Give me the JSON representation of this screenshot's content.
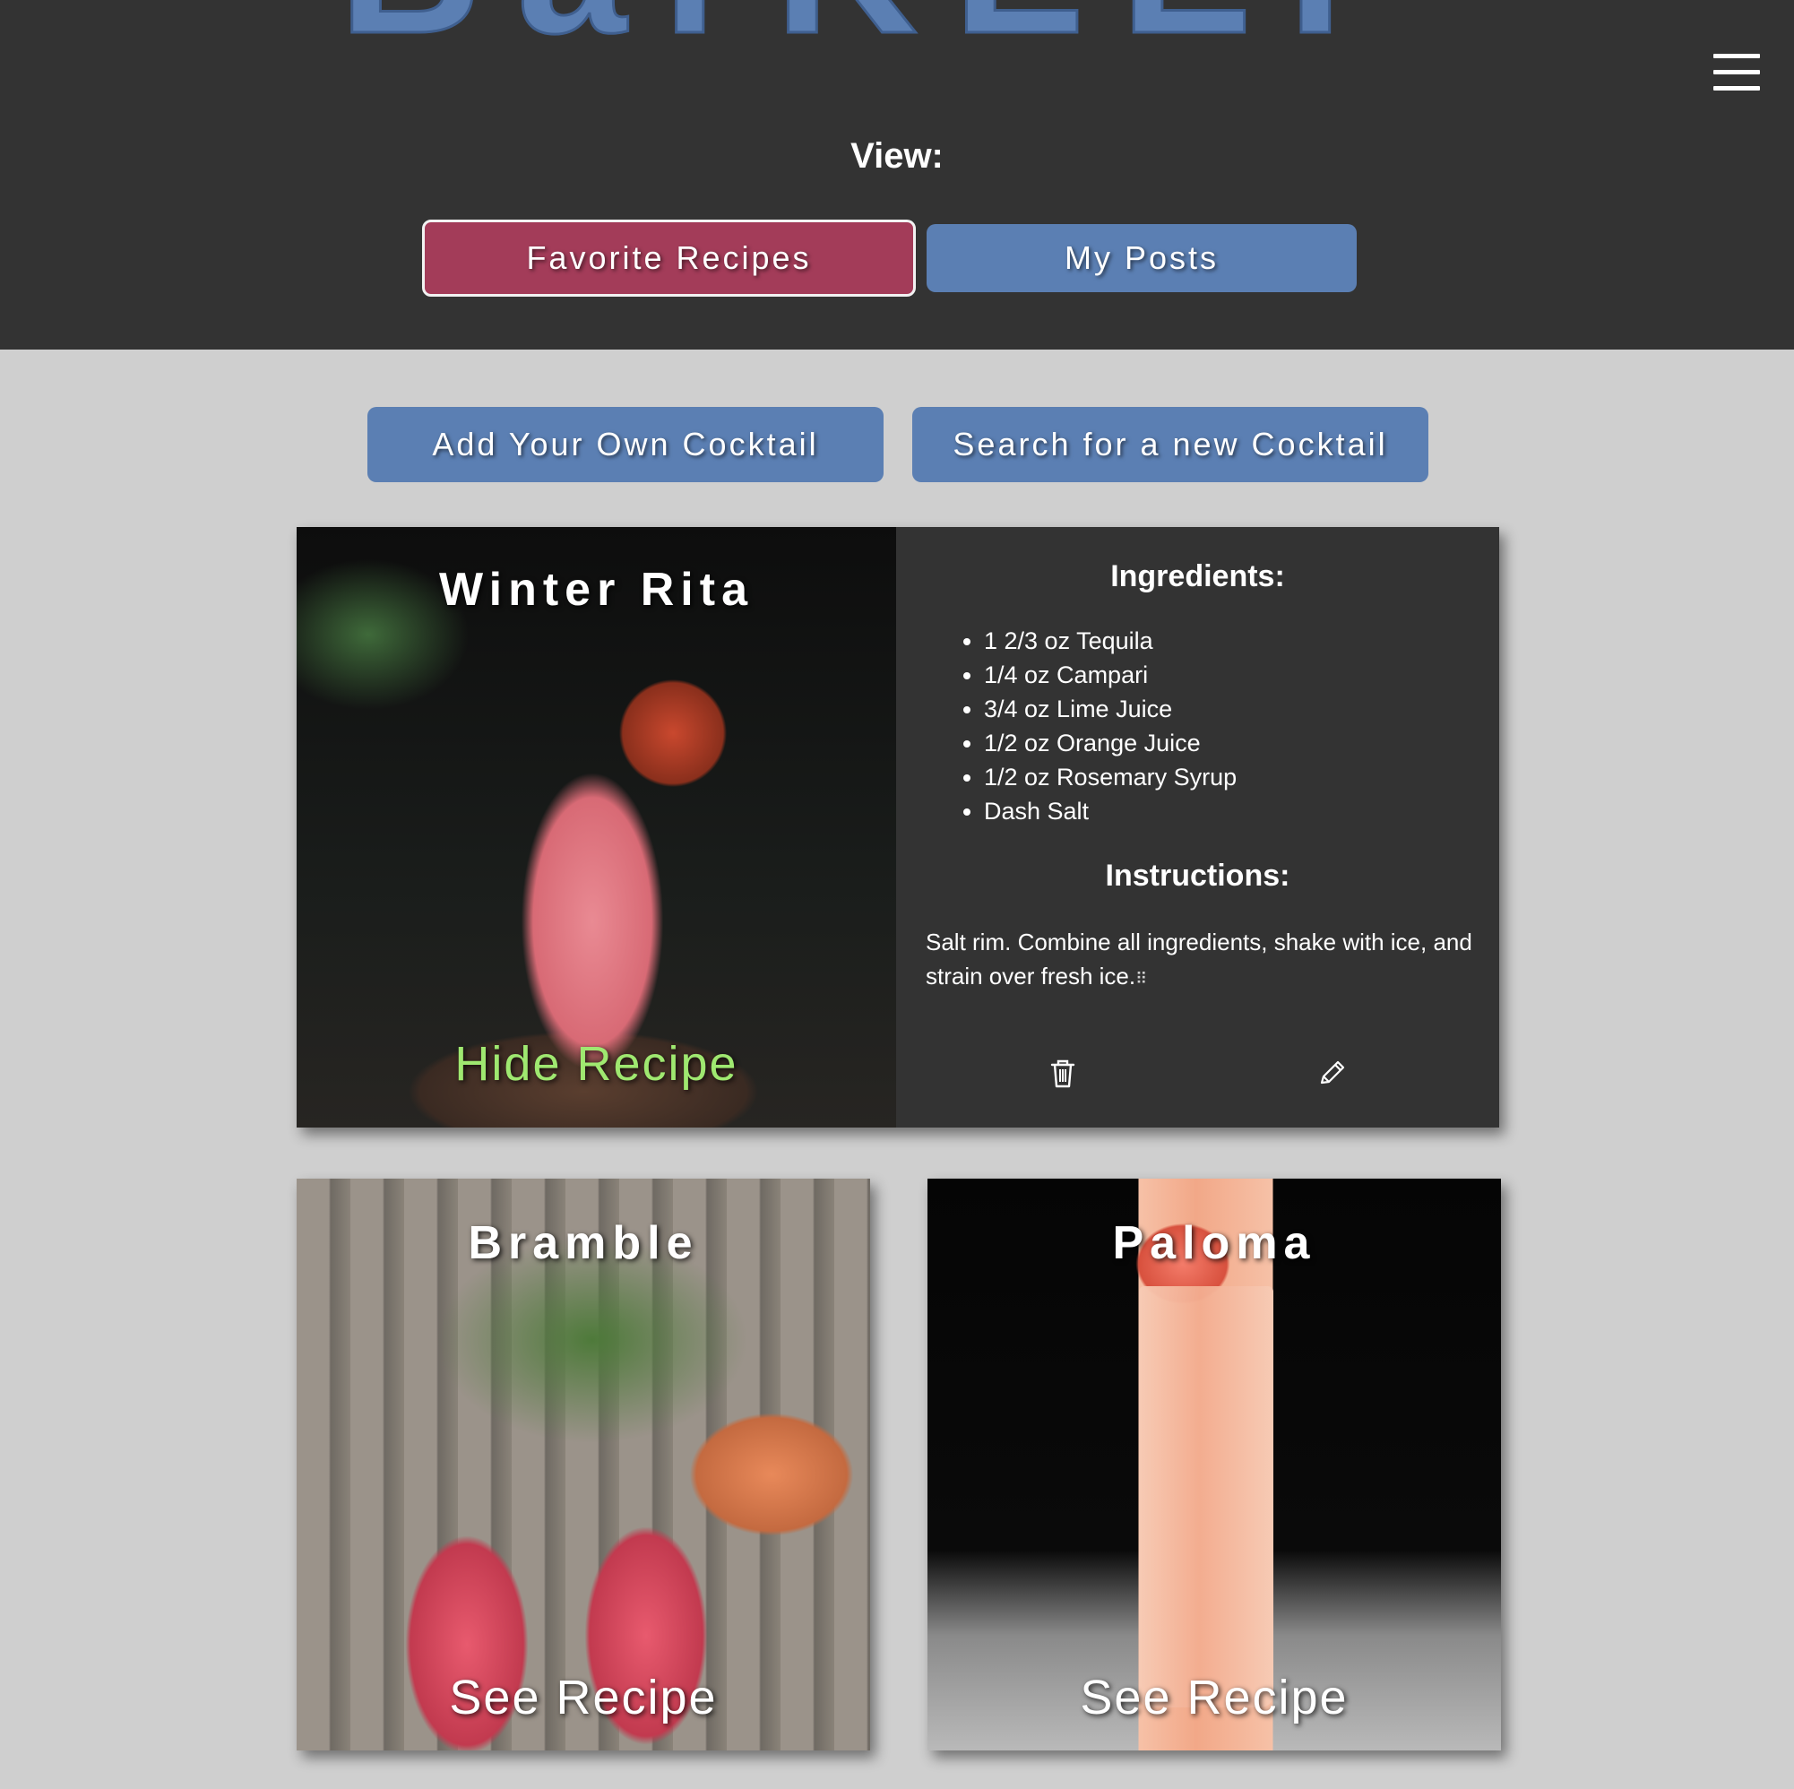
{
  "header": {
    "brand": "BarKEEP",
    "view_label": "View:",
    "menu_icon": "hamburger-icon",
    "tabs": {
      "favorites": "Favorite Recipes",
      "my_posts": "My Posts"
    }
  },
  "actions": {
    "add": "Add Your Own Cocktail",
    "search": "Search for a new Cocktail"
  },
  "cards": [
    {
      "title": "Winter Rita",
      "toggle": "Hide Recipe",
      "ingredients_heading": "Ingredients:",
      "ingredients": [
        "1 2/3 oz Tequila",
        "1/4 oz Campari",
        "3/4 oz Lime Juice",
        "1/2 oz Orange Juice",
        "1/2 oz Rosemary Syrup",
        "Dash Salt"
      ],
      "instructions_heading": "Instructions:",
      "instructions": "Salt rim. Combine all ingredients, shake with ice, and strain over fresh ice.",
      "trash_icon": "trash-icon",
      "edit_icon": "pencil-icon"
    },
    {
      "title": "Bramble",
      "toggle": "See Recipe"
    },
    {
      "title": "Paloma",
      "toggle": "See Recipe"
    }
  ],
  "colors": {
    "header_bg": "#333333",
    "page_bg": "#cfcfcf",
    "brand_blue": "#5b7fb3",
    "active_tab": "#a33c59",
    "hide_link": "#9fe870"
  }
}
